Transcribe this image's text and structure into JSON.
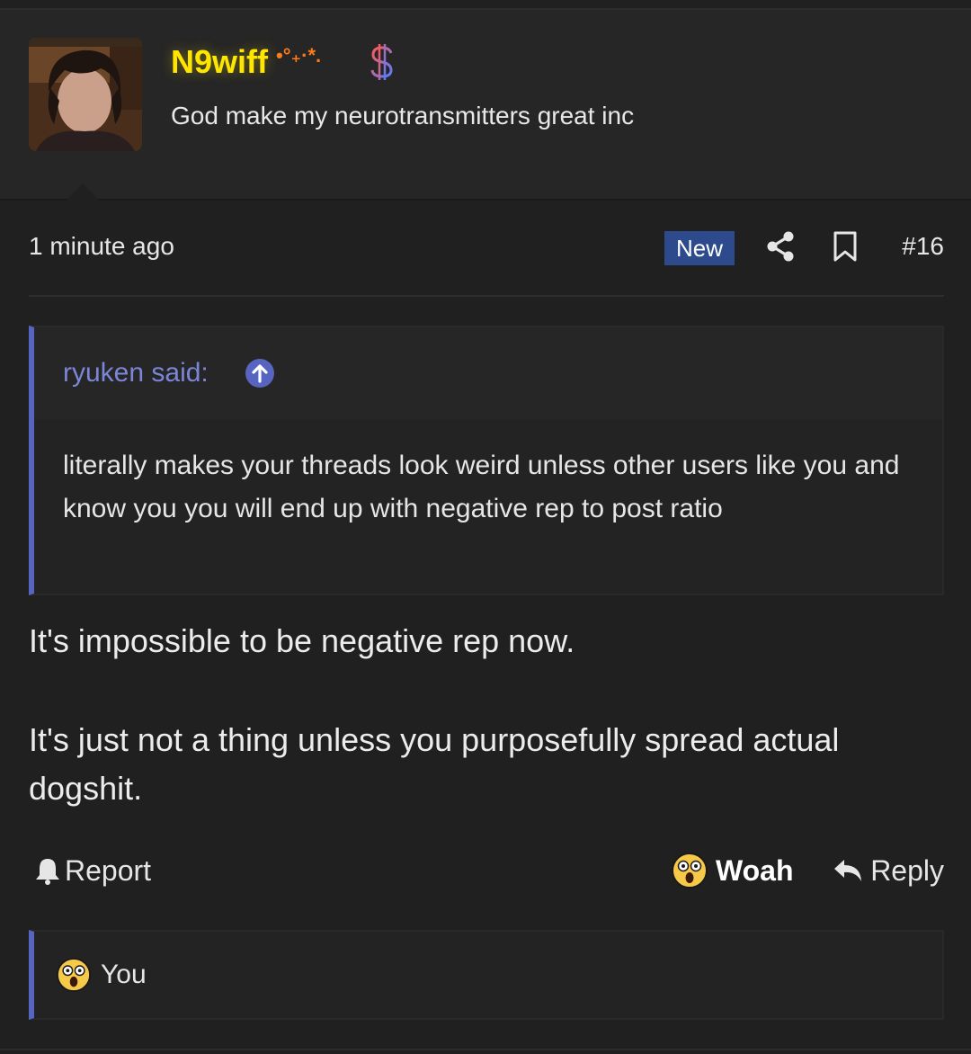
{
  "author": {
    "name": "N9wiff",
    "name_decoration": "•°₊·*.",
    "title": "God make my neurotransmitters great inc",
    "name_color": "#ffe600",
    "badge_icon": "dollar-icon"
  },
  "post": {
    "time": "1 minute ago",
    "badge": "New",
    "number": "#16",
    "quote": {
      "author_label": "ryuken said:",
      "text": "literally makes your threads look weird unless other users like you and know you you will end up with negative rep to post ratio"
    },
    "paragraphs": [
      "It's impossible to be negative rep now.",
      "It's just not a thing unless you purposefully spread actual dogshit."
    ]
  },
  "actions": {
    "report_label": "Report",
    "reaction_label": "Woah",
    "reply_label": "Reply"
  },
  "reactions": {
    "users_label": "You",
    "emoji": "astonished-face-emoji"
  },
  "colors": {
    "background": "#202020",
    "header_bg": "#262626",
    "accent": "#5865c0",
    "quote_author": "#7b86d6",
    "new_badge": "#2c4a8c"
  }
}
